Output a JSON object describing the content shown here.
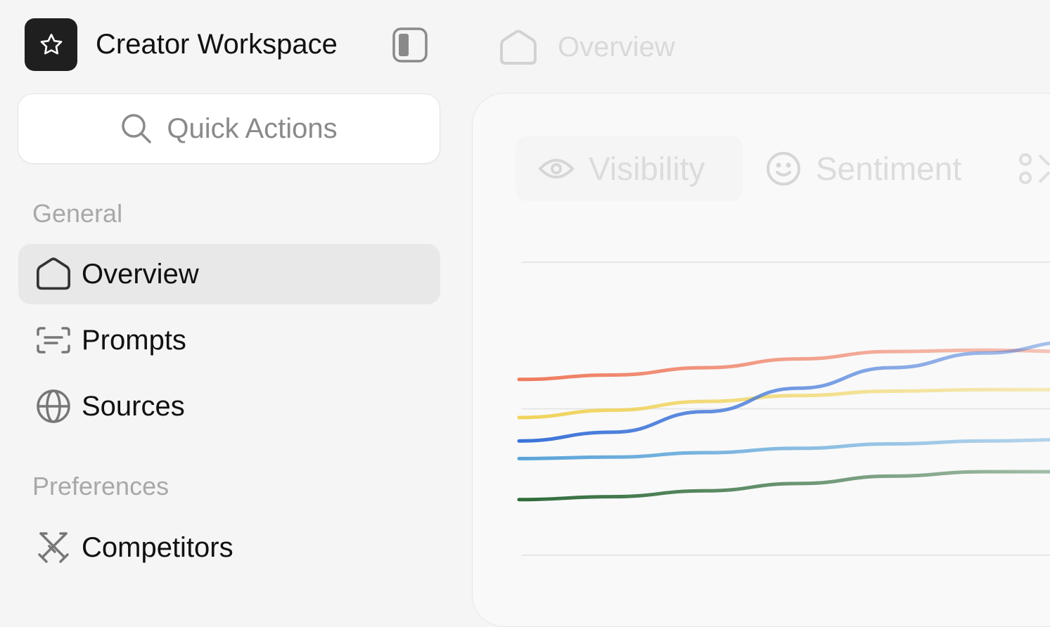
{
  "app": {
    "title": "Creator Workspace"
  },
  "header": {
    "breadcrumb": "Overview"
  },
  "search": {
    "label": "Quick Actions"
  },
  "sidebar": {
    "sections": [
      {
        "label": "General"
      },
      {
        "label": "Preferences"
      }
    ],
    "items": [
      {
        "label": "Overview",
        "icon": "home-icon",
        "active": true
      },
      {
        "label": "Prompts",
        "icon": "prompts-icon",
        "active": false
      },
      {
        "label": "Sources",
        "icon": "globe-icon",
        "active": false
      },
      {
        "label": "Competitors",
        "icon": "swords-icon",
        "active": false
      }
    ]
  },
  "main": {
    "tabs": [
      {
        "label": "Visibility",
        "icon": "eye-icon",
        "active": true
      },
      {
        "label": "Sentiment",
        "icon": "smile-icon",
        "active": false
      }
    ]
  },
  "colors": {
    "background": "#f5f5f5",
    "active_nav": "#e8e8e8",
    "series_colors": [
      "#ef7b5e",
      "#f0d35a",
      "#3a72d8",
      "#5aa3d8",
      "#2f6b3a"
    ]
  },
  "chart_data": {
    "type": "line",
    "title": "",
    "xlabel": "",
    "ylabel": "",
    "grid": true,
    "x": [
      0,
      1,
      2,
      3,
      4,
      5,
      6
    ],
    "ylim": [
      0,
      100
    ],
    "series": [
      {
        "color": "#ef7b5e",
        "values": [
          60,
          61.5,
          64,
          67,
          69.5,
          70,
          69.5
        ]
      },
      {
        "color": "#f0d35a",
        "values": [
          47,
          49.5,
          52.5,
          54.5,
          56,
          56.5,
          56.5
        ]
      },
      {
        "color": "#3a72d8",
        "values": [
          39,
          42,
          49,
          57,
          64,
          69,
          73
        ]
      },
      {
        "color": "#5aa3d8",
        "values": [
          33,
          33.5,
          35,
          36.5,
          38,
          39,
          39.5
        ]
      },
      {
        "color": "#2f6b3a",
        "values": [
          19,
          20,
          22,
          24.5,
          27,
          28.5,
          28.5
        ]
      }
    ]
  }
}
